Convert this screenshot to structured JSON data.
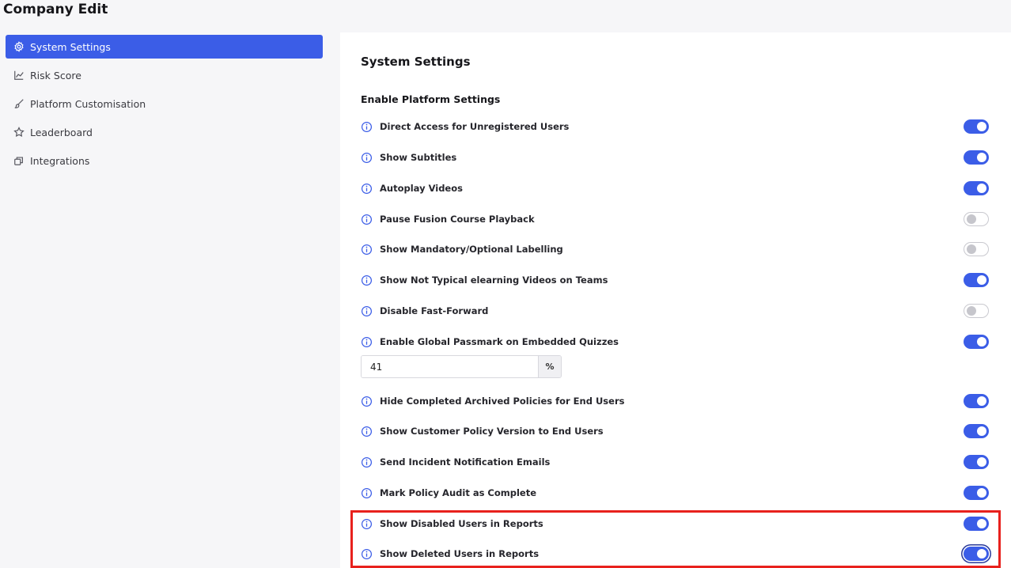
{
  "header": {
    "title": "Company Edit"
  },
  "sidebar": {
    "items": [
      {
        "label": "System Settings",
        "icon": "gear-icon",
        "active": true
      },
      {
        "label": "Risk Score",
        "icon": "chart-line-icon",
        "active": false
      },
      {
        "label": "Platform Customisation",
        "icon": "brush-icon",
        "active": false
      },
      {
        "label": "Leaderboard",
        "icon": "star-icon",
        "active": false
      },
      {
        "label": "Integrations",
        "icon": "layers-icon",
        "active": false
      }
    ]
  },
  "main": {
    "title": "System Settings",
    "section_title": "Enable Platform Settings",
    "settings": [
      {
        "label": "Direct Access for Unregistered Users",
        "enabled": true
      },
      {
        "label": "Show Subtitles",
        "enabled": true
      },
      {
        "label": "Autoplay Videos",
        "enabled": true
      },
      {
        "label": "Pause Fusion Course Playback",
        "enabled": false
      },
      {
        "label": "Show Mandatory/Optional Labelling",
        "enabled": false
      },
      {
        "label": "Show Not Typical elearning Videos on Teams",
        "enabled": true
      },
      {
        "label": "Disable Fast-Forward",
        "enabled": false
      },
      {
        "label": "Enable Global Passmark on Embedded Quizzes",
        "enabled": true
      },
      {
        "label": "Hide Completed Archived Policies for End Users",
        "enabled": true
      },
      {
        "label": "Show Customer Policy Version to End Users",
        "enabled": true
      },
      {
        "label": "Send Incident Notification Emails",
        "enabled": true
      },
      {
        "label": "Mark Policy Audit as Complete",
        "enabled": true
      },
      {
        "label": "Show Disabled Users in Reports",
        "enabled": true
      },
      {
        "label": "Show Deleted Users in Reports",
        "enabled": true,
        "focused": true
      }
    ],
    "passmark": {
      "value": "41",
      "suffix": "%"
    }
  },
  "colors": {
    "accent": "#3b5de7",
    "highlight": "#e8211d"
  }
}
